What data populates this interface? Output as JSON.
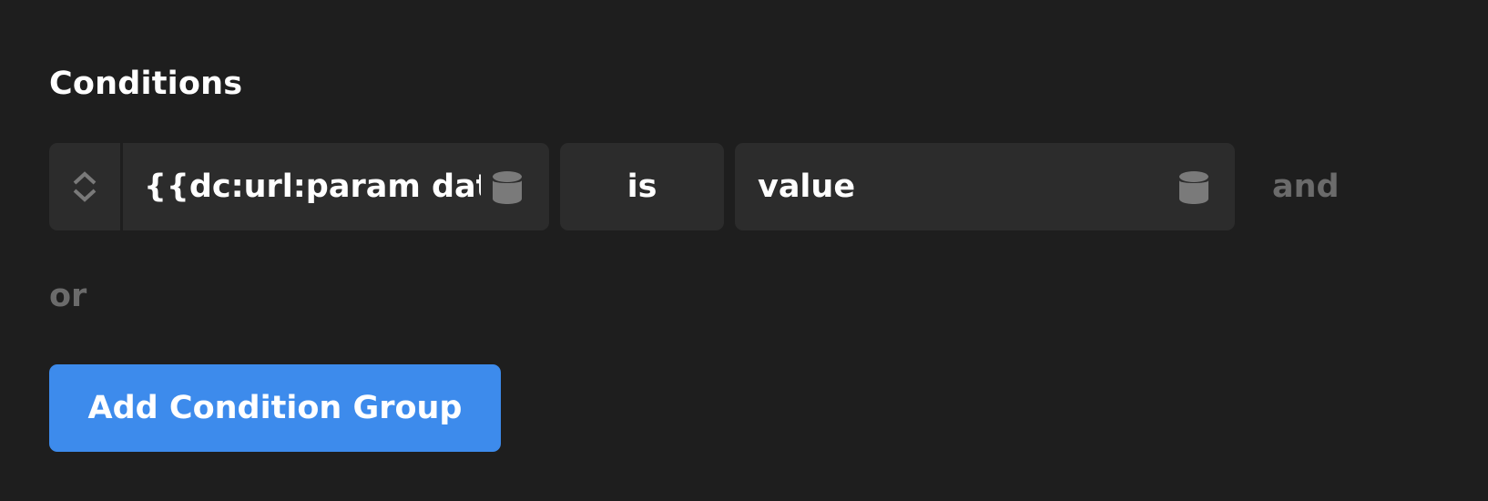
{
  "section": {
    "title": "Conditions"
  },
  "condition": {
    "source_value": "{{dc:url:param data",
    "operator": "is",
    "value": "value",
    "source_icon": "database-icon",
    "value_icon": "database-icon",
    "handle_icon": "chevron-up-down-icon",
    "join_label": "and"
  },
  "group_join_label": "or",
  "add_group_button": "Add Condition Group",
  "colors": {
    "background": "#1e1e1e",
    "control_background": "#2c2c2c",
    "muted_text": "#6b6b6b",
    "icon": "#7a7a7a",
    "accent": "#3d8bec",
    "text": "#ffffff"
  }
}
